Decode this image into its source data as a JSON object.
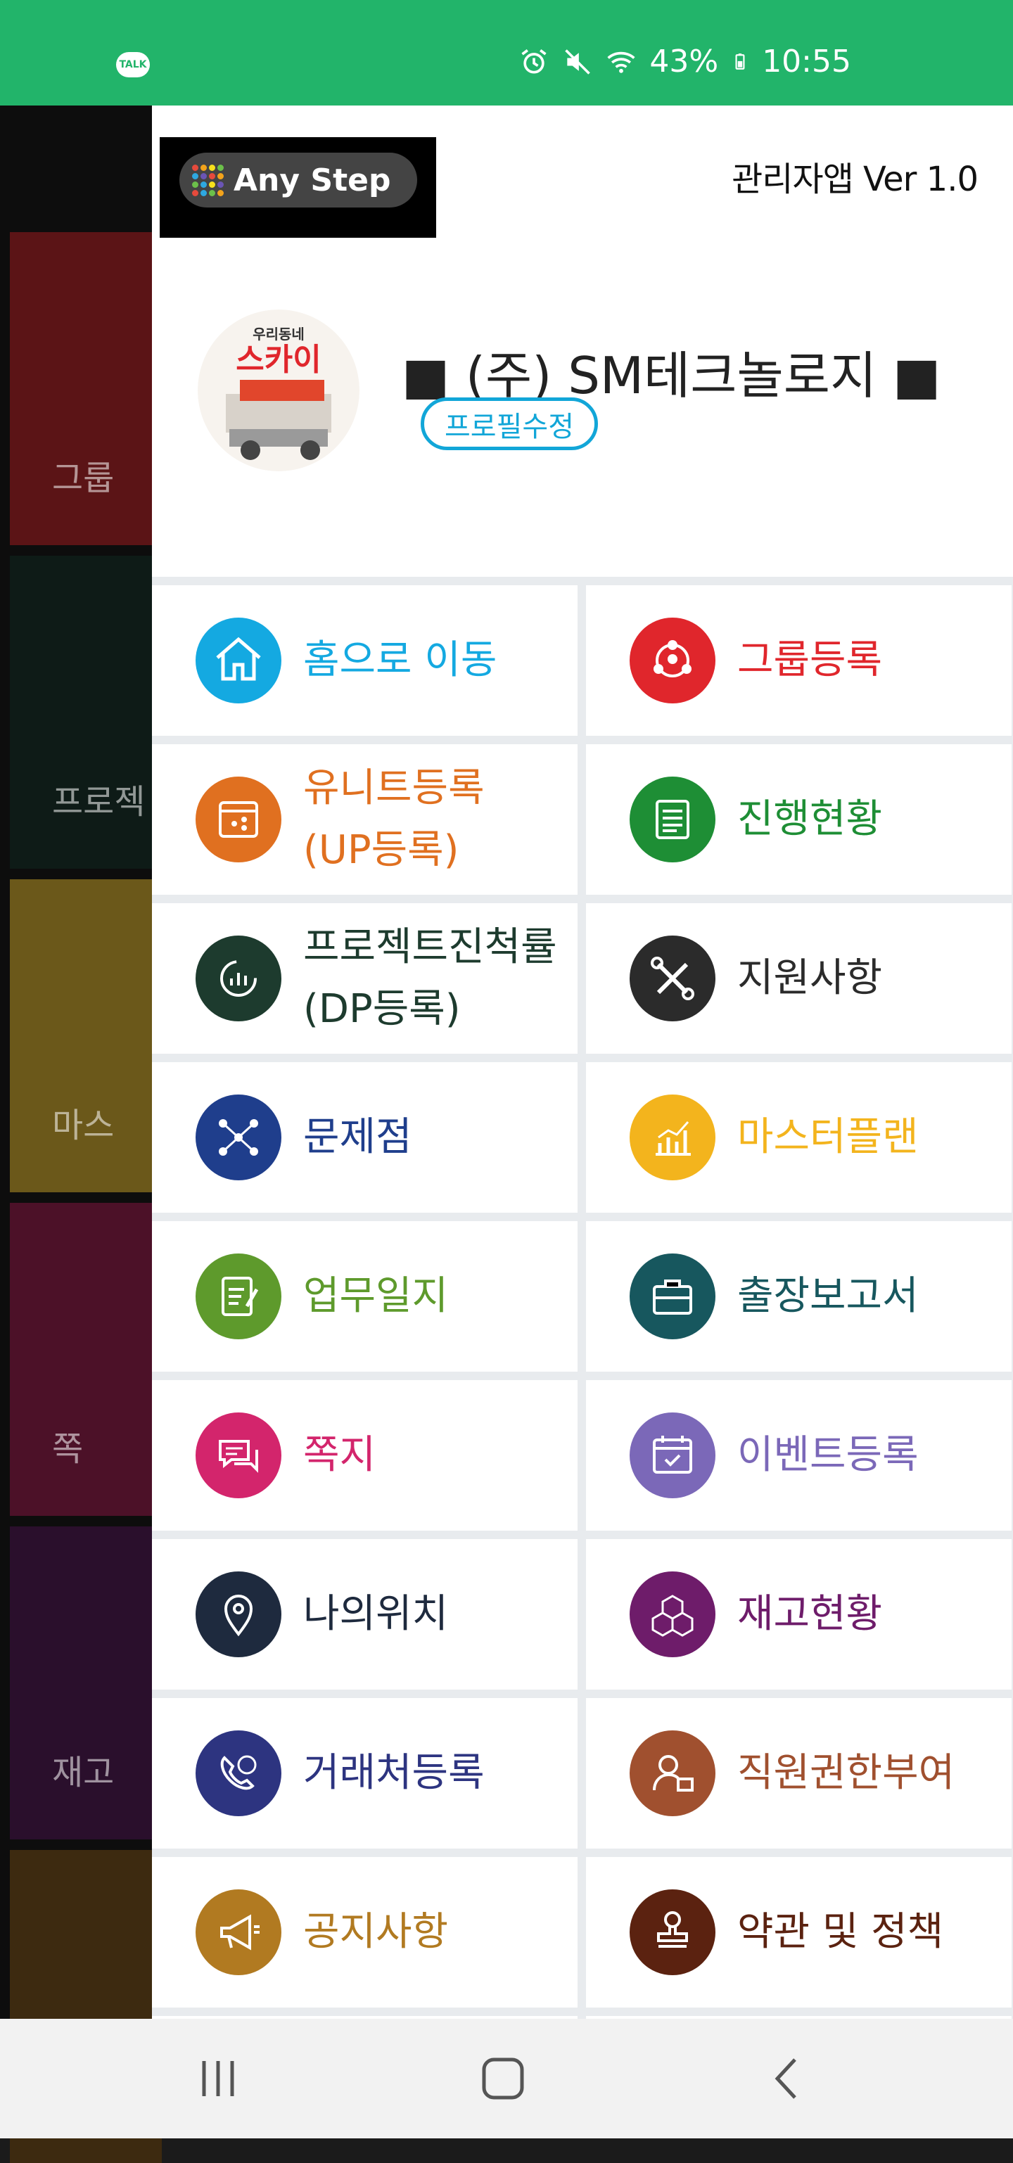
{
  "status_bar": {
    "talk_badge": "TALK",
    "battery": "43%",
    "time": "10:55",
    "icons": [
      "kakaotalk-icon",
      "alarm-icon",
      "mute-icon",
      "wifi-icon",
      "battery-icon"
    ]
  },
  "background_menu": {
    "tiles": [
      {
        "label": "그룹",
        "color": "#5b1416"
      },
      {
        "label": "프로젝",
        "color": "#0e1b17"
      },
      {
        "label": "마스",
        "color": "#6b581a"
      },
      {
        "label": "쪽",
        "color": "#4c1128"
      },
      {
        "label": "재고",
        "color": "#2a0f2c"
      },
      {
        "label": "",
        "color": "#3d2a10"
      }
    ]
  },
  "drawer": {
    "logo_text": "Any Step",
    "version": "관리자앱 Ver 1.0",
    "avatar_text_top": "우리동네",
    "avatar_text_main": "스카이",
    "company_name": "■ (주) SM테크놀로지 ■",
    "profile_edit": "프로필수정"
  },
  "menu": [
    {
      "label": "홈으로 이동",
      "color": "#14a9e1",
      "icon": "home-icon"
    },
    {
      "label": "그룹등록",
      "color": "#e0262c",
      "icon": "group-icon"
    },
    {
      "label": "유니트등록\n(UP등록)",
      "color": "#e07020",
      "icon": "unit-icon"
    },
    {
      "label": "진행현황",
      "color": "#1e8e35",
      "icon": "document-icon"
    },
    {
      "label": "프로젝트진척률\n(DP등록)",
      "color": "#1d3b2e",
      "icon": "progress-icon"
    },
    {
      "label": "지원사항",
      "color": "#2b2b2b",
      "icon": "tools-icon"
    },
    {
      "label": "문제점",
      "color": "#1f3e8c",
      "icon": "network-icon"
    },
    {
      "label": "마스터플랜",
      "color": "#f3b41d",
      "icon": "chart-icon"
    },
    {
      "label": "업무일지",
      "color": "#5e9a2c",
      "icon": "journal-icon"
    },
    {
      "label": "출장보고서",
      "color": "#17575e",
      "icon": "briefcase-icon"
    },
    {
      "label": "쪽지",
      "color": "#d3256c",
      "icon": "message-icon"
    },
    {
      "label": "이벤트등록",
      "color": "#7b68b8",
      "icon": "calendar-icon"
    },
    {
      "label": "나의위치",
      "color": "#1e2a3e",
      "icon": "location-icon"
    },
    {
      "label": "재고현황",
      "color": "#6e1c6a",
      "icon": "boxes-icon"
    },
    {
      "label": "거래처등록",
      "color": "#2d3480",
      "icon": "contact-icon"
    },
    {
      "label": "직원권한부여",
      "color": "#a0502f",
      "icon": "user-stamp-icon"
    },
    {
      "label": "공지사항",
      "color": "#b17a21",
      "icon": "megaphone-icon"
    },
    {
      "label": "약관 및 정책",
      "color": "#5b2210",
      "icon": "stamp-icon"
    }
  ],
  "nav_bar": {
    "icons": [
      "recent-apps-icon",
      "home-button-icon",
      "back-icon"
    ]
  }
}
